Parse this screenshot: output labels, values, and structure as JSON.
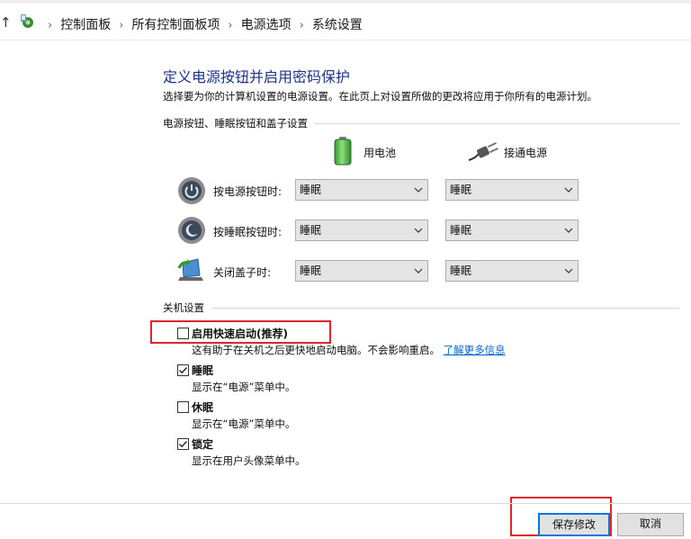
{
  "breadcrumb": [
    "控制面板",
    "所有控制面板项",
    "电源选项",
    "系统设置"
  ],
  "heading": {
    "title": "定义电源按钮并启用密码保护",
    "description": "选择要为你的计算机设置的电源设置。在此页上对设置所做的更改将应用于你所有的电源计划。"
  },
  "buttons_section": {
    "title": "电源按钮、睡眠按钮和盖子设置",
    "columns": [
      "用电池",
      "接通电源"
    ],
    "rows": [
      {
        "label": "按电源按钮时:",
        "battery": "睡眠",
        "plugged": "睡眠"
      },
      {
        "label": "按睡眠按钮时:",
        "battery": "睡眠",
        "plugged": "睡眠"
      },
      {
        "label": "关闭盖子时:",
        "battery": "睡眠",
        "plugged": "睡眠"
      }
    ]
  },
  "shutdown_section": {
    "title": "关机设置",
    "options": [
      {
        "label": "启用快速启动(推荐)",
        "checked": false,
        "description": "这有助于在关机之后更快地启动电脑。不会影响重启。",
        "link": "了解更多信息"
      },
      {
        "label": "睡眠",
        "checked": true,
        "description": "显示在“电源”菜单中。"
      },
      {
        "label": "休眠",
        "checked": false,
        "description": "显示在“电源”菜单中。"
      },
      {
        "label": "锁定",
        "checked": true,
        "description": "显示在用户头像菜单中。"
      }
    ]
  },
  "actions": {
    "save": "保存修改",
    "cancel": "取消"
  },
  "colors": {
    "title": "#1e3287",
    "link": "#0066cc",
    "highlight": "#e0252b",
    "focus": "#0078d7"
  },
  "icons": [
    "up-arrow-icon",
    "control-panel-icon",
    "battery-icon",
    "plug-icon",
    "power-button-icon",
    "sleep-button-icon",
    "laptop-lid-icon",
    "chevron-down-icon",
    "checkmark-icon"
  ]
}
